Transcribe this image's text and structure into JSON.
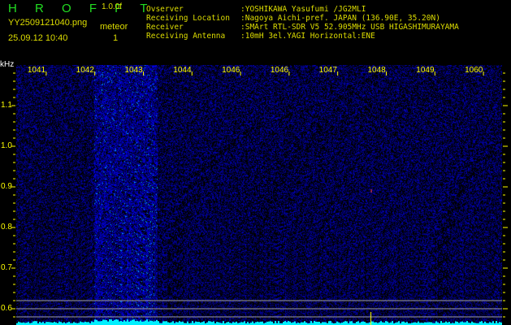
{
  "header": {
    "app_title": "H R O F F T",
    "version": "1.0.0f",
    "filename": "YY2509121040.png",
    "meteor_label": "meteor",
    "datetime": "25.09.12 10:40",
    "meteor_count": "1"
  },
  "info": [
    {
      "label": "Ovserver",
      "value": ":YOSHIKAWA Yasufumi /JG2MLI"
    },
    {
      "label": "Receiving Location",
      "value": ":Nagoya Aichi-pref. JAPAN (136.90E, 35.20N)"
    },
    {
      "label": "Receiver",
      "value": ":SMArt RTL-SDR V5 52.905MHz USB HIGASHIMURAYAMA"
    },
    {
      "label": "Receiving Antenna",
      "value": ":10mH 3el.YAGI Horizontal:ENE"
    }
  ],
  "colors": {
    "title": "#22dd22",
    "text": "#dddd00",
    "noise": "#1020c0",
    "spectrum": "#00f0ff",
    "guide_lines": "#a0a0a0",
    "marker": "#ffff00"
  },
  "chart_data": {
    "type": "heatmap",
    "xlabel": "",
    "ylabel": "kHz",
    "x_tick_labels": [
      "1041",
      "1042",
      "1043",
      "1044",
      "1046",
      "1046",
      "1047",
      "1048",
      "1049",
      "1060"
    ],
    "y_tick_labels": [
      "1.1",
      "1.0",
      "0.9",
      "0.8",
      "0.7",
      "0.6"
    ],
    "y_ticks": [
      1.1,
      1.0,
      0.9,
      0.8,
      0.7,
      0.6
    ],
    "ylim": [
      0.56,
      1.2
    ],
    "xlim": [
      1040.4,
      1050.4
    ],
    "meteor_band_x": [
      1042.0,
      1043.3
    ],
    "guide_lines_y": [
      0.62,
      0.6,
      0.58
    ],
    "marker_x": 1047.7,
    "spot": {
      "x": 1047.7,
      "y": 0.89
    }
  }
}
